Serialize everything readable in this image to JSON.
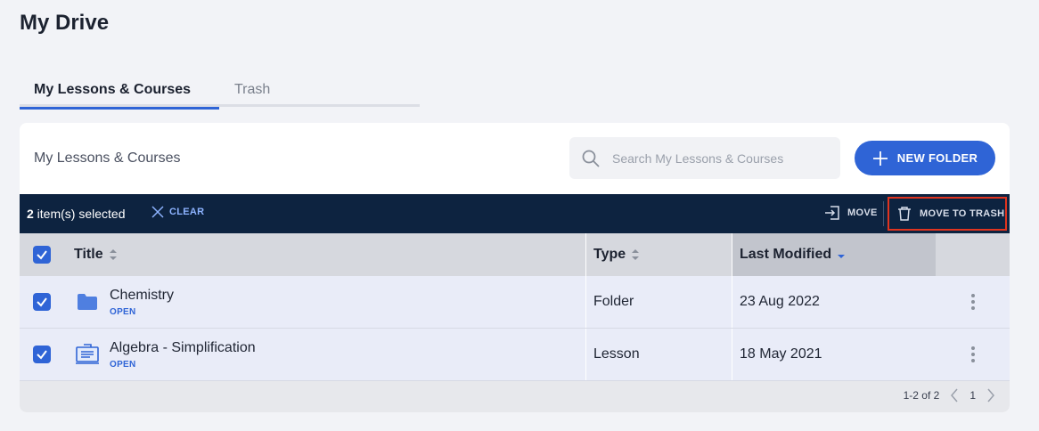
{
  "page": {
    "title": "My Drive"
  },
  "tabs": [
    {
      "label": "My Lessons & Courses",
      "active": true
    },
    {
      "label": "Trash",
      "active": false
    }
  ],
  "header": {
    "heading": "My Lessons & Courses",
    "search_placeholder": "Search My Lessons & Courses",
    "new_folder_label": "NEW FOLDER"
  },
  "selection": {
    "count": "2",
    "suffix": " item(s) selected",
    "clear_label": "CLEAR",
    "move_label": "MOVE",
    "trash_label": "MOVE TO TRASH"
  },
  "table": {
    "columns": {
      "title": "Title",
      "type": "Type",
      "modified": "Last Modified"
    },
    "rows": [
      {
        "name": "Chemistry",
        "open": "OPEN",
        "type": "Folder",
        "modified": "23 Aug 2022",
        "icon": "folder-icon",
        "checked": true
      },
      {
        "name": "Algebra - Simplification",
        "open": "OPEN",
        "type": "Lesson",
        "modified": "18 May 2021",
        "icon": "lesson-icon",
        "checked": true
      }
    ]
  },
  "pagination": {
    "range": "1-2 of 2",
    "page": "1"
  },
  "colors": {
    "accent": "#2f64d6",
    "bar": "#0d2340",
    "highlight": "#e0341f"
  }
}
